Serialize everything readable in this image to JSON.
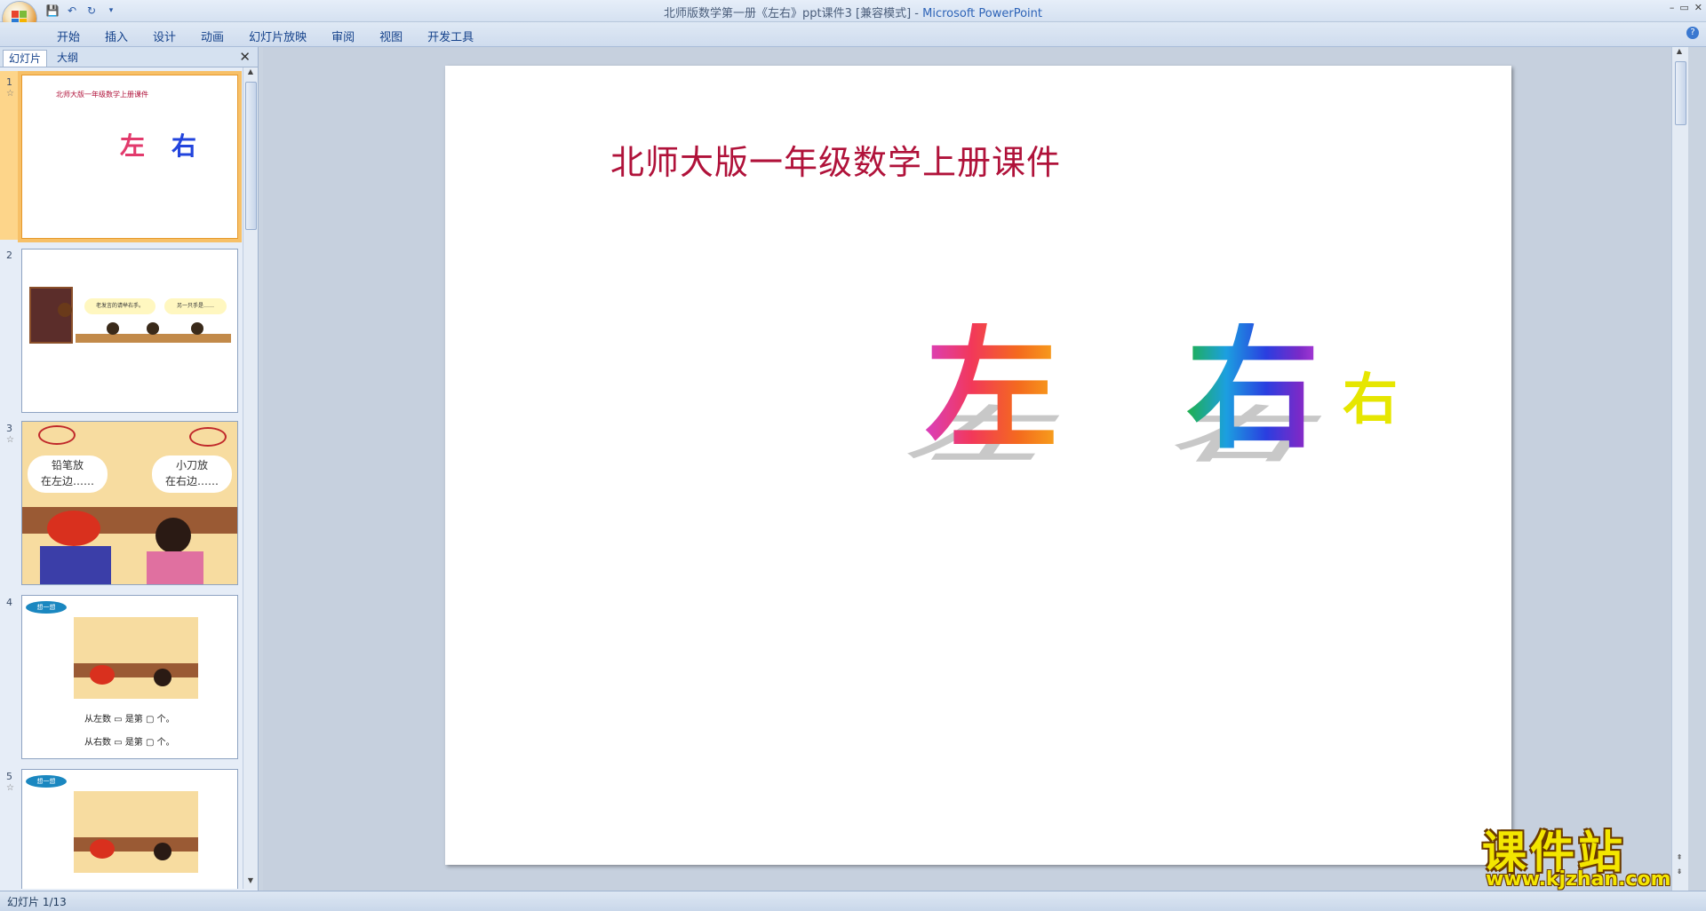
{
  "window": {
    "title_prefix": "北师版数学第一册《左右》ppt课件3 [兼容模式] - ",
    "app_name": "Microsoft PowerPoint",
    "controls": [
      "–",
      "▭",
      "✕"
    ]
  },
  "ribbon": {
    "tabs": [
      "开始",
      "插入",
      "设计",
      "动画",
      "幻灯片放映",
      "审阅",
      "视图",
      "开发工具"
    ],
    "help": "?"
  },
  "left_pane": {
    "tabs": [
      "幻灯片",
      "大纲"
    ],
    "close": "✕",
    "thumbnails": [
      {
        "num": "1",
        "text": "北师大版一年级数学上册课件",
        "chars": [
          "左",
          "右"
        ]
      },
      {
        "num": "2",
        "bubbles": [
          "老发言的请举右手。",
          "另一只手是……"
        ]
      },
      {
        "num": "3",
        "bubbles": [
          "铅笔放",
          "在左边……",
          "小刀放",
          "在右边……"
        ]
      },
      {
        "num": "4",
        "badge": "想一想",
        "lines": [
          "从左数",
          "是第",
          "个。",
          "从右数",
          "是第",
          "个。"
        ]
      },
      {
        "num": "5",
        "badge": "想一想"
      }
    ]
  },
  "slide": {
    "title": "北师大版一年级数学上册课件",
    "left_char": "左",
    "right_char": "右",
    "small_char": "右"
  },
  "status": {
    "text": "幻灯片 1/13"
  },
  "watermark": {
    "line1": "课件站",
    "line2": "www.kjzhan.com"
  }
}
